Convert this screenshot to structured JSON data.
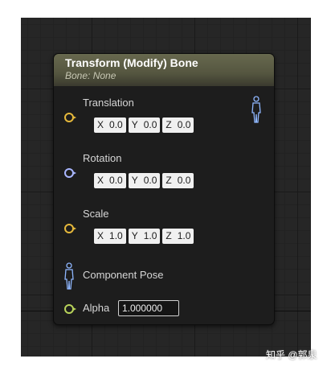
{
  "node": {
    "title": "Transform (Modify) Bone",
    "subtitle": "Bone: None"
  },
  "pins": {
    "translation": {
      "label": "Translation",
      "x": "0.0",
      "y": "0.0",
      "z": "0.0"
    },
    "rotation": {
      "label": "Rotation",
      "x": "0.0",
      "y": "0.0",
      "z": "0.0"
    },
    "scale": {
      "label": "Scale",
      "x": "1.0",
      "y": "1.0",
      "z": "1.0"
    },
    "component_pose": {
      "label": "Component Pose"
    },
    "alpha": {
      "label": "Alpha",
      "value": "1.000000"
    }
  },
  "axis_labels": {
    "x": "X",
    "y": "Y",
    "z": "Z"
  },
  "watermark": "知乎 @郭泉",
  "colors": {
    "vector_pin": "#e5b83b",
    "rotator_pin": "#a9b6ff",
    "float_pin": "#b8d35a",
    "pose_icon": "#8fb7ff"
  },
  "icons": [
    "pose-output-icon",
    "pose-input-icon"
  ]
}
